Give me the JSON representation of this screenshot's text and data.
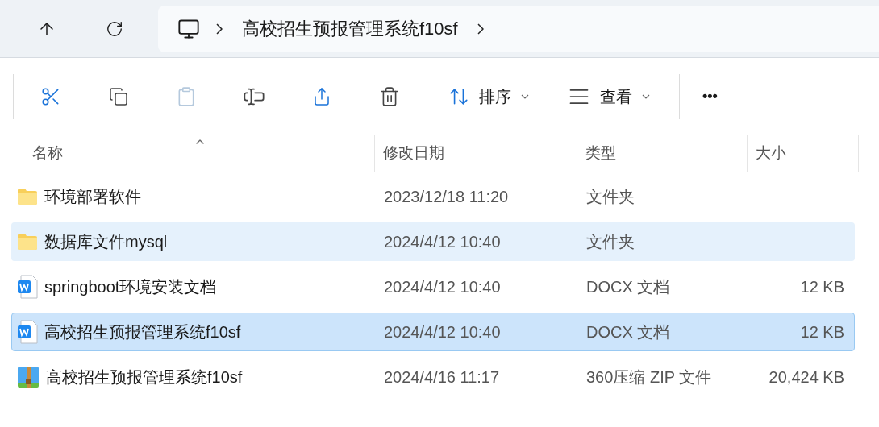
{
  "nav": {
    "breadcrumb": "高校招生预报管理系统f10sf"
  },
  "toolbar": {
    "sort_label": "排序",
    "view_label": "查看",
    "more": "•••"
  },
  "table": {
    "columns": [
      "名称",
      "修改日期",
      "类型",
      "大小"
    ],
    "rows": [
      {
        "kind": "folder",
        "name": "环境部署软件",
        "date": "2023/12/18 11:20",
        "type": "文件夹",
        "size": "",
        "selected": false,
        "hovered": false
      },
      {
        "kind": "folder",
        "name": "数据库文件mysql",
        "date": "2024/4/12 10:40",
        "type": "文件夹",
        "size": "",
        "selected": false,
        "hovered": true
      },
      {
        "kind": "docx",
        "name": "springboot环境安装文档",
        "date": "2024/4/12 10:40",
        "type": "DOCX 文档",
        "size": "12 KB",
        "selected": false,
        "hovered": false
      },
      {
        "kind": "docx",
        "name": "高校招生预报管理系统f10sf",
        "date": "2024/4/12 10:40",
        "type": "DOCX 文档",
        "size": "12 KB",
        "selected": true,
        "hovered": false
      },
      {
        "kind": "zip",
        "name": "高校招生预报管理系统f10sf",
        "date": "2024/4/16 11:17",
        "type": "360压缩 ZIP 文件",
        "size": "20,424 KB",
        "selected": false,
        "hovered": false
      }
    ]
  }
}
